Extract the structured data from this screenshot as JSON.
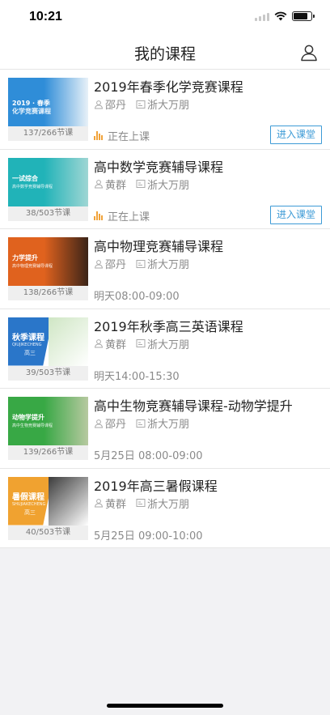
{
  "status_bar": {
    "time": "10:21"
  },
  "header": {
    "title": "我的课程"
  },
  "courses": [
    {
      "title": "2019年春季化学竞赛课程",
      "teacher": "邵丹",
      "org": "浙大万朋",
      "lessons": "137/266节课",
      "status": "正在上课",
      "live": true,
      "action": "进入课堂",
      "thumb": {
        "line1": "2019 · 春季",
        "line2": "化学竞赛课程",
        "color1": "#2f8dd8",
        "color2": "#e8f1f8"
      }
    },
    {
      "title": "高中数学竞赛辅导课程",
      "teacher": "黄群",
      "org": "浙大万朋",
      "lessons": "38/503节课",
      "status": "正在上课",
      "live": true,
      "action": "进入课堂",
      "thumb": {
        "line1": "一试综合",
        "line2": "高中数学竞赛辅导课程",
        "color1": "#21b3b8",
        "color2": "#9fd6d4"
      }
    },
    {
      "title": "高中物理竞赛辅导课程",
      "teacher": "邵丹",
      "org": "浙大万朋",
      "lessons": "138/266节课",
      "status": "明天08:00-09:00",
      "live": false,
      "action": "",
      "thumb": {
        "line1": "力学提升",
        "line2": "高中物理竞赛辅导课程",
        "color1": "#e0621e",
        "color2": "#3b2418"
      }
    },
    {
      "title": "2019年秋季高三英语课程",
      "teacher": "黄群",
      "org": "浙大万朋",
      "lessons": "39/503节课",
      "status": "明天14:00-15:30",
      "live": false,
      "action": "",
      "thumb": {
        "line1": "秋季课程",
        "line2": "QIUJIKECHENG",
        "line3": "高三",
        "color1": "#2a76c9",
        "color2": "#cfe6c4"
      }
    },
    {
      "title": "高中生物竞赛辅导课程-动物学提升",
      "teacher": "邵丹",
      "org": "浙大万朋",
      "lessons": "139/266节课",
      "status": "5月25日  08:00-09:00",
      "live": false,
      "action": "",
      "thumb": {
        "line1": "动物学提升",
        "line2": "高中生物竞赛辅导课程",
        "color1": "#38a845",
        "color2": "#b7c9a0"
      }
    },
    {
      "title": "2019年高三暑假课程",
      "teacher": "黄群",
      "org": "浙大万朋",
      "lessons": "40/503节课",
      "status": "5月25日  09:00-10:00",
      "live": false,
      "action": "",
      "thumb": {
        "line1": "暑假课程",
        "line2": "SHUJIAKECHENG",
        "line3": "高三",
        "color1": "#f0a230",
        "color2": "#3c3c3c"
      }
    }
  ],
  "icons": {
    "profile": "person-outline-icon",
    "teacher": "person-outline-icon",
    "org": "school-card-icon",
    "live": "live-bars-icon"
  },
  "colors": {
    "accent": "#3d9bd6",
    "live": "#f1a33a"
  }
}
